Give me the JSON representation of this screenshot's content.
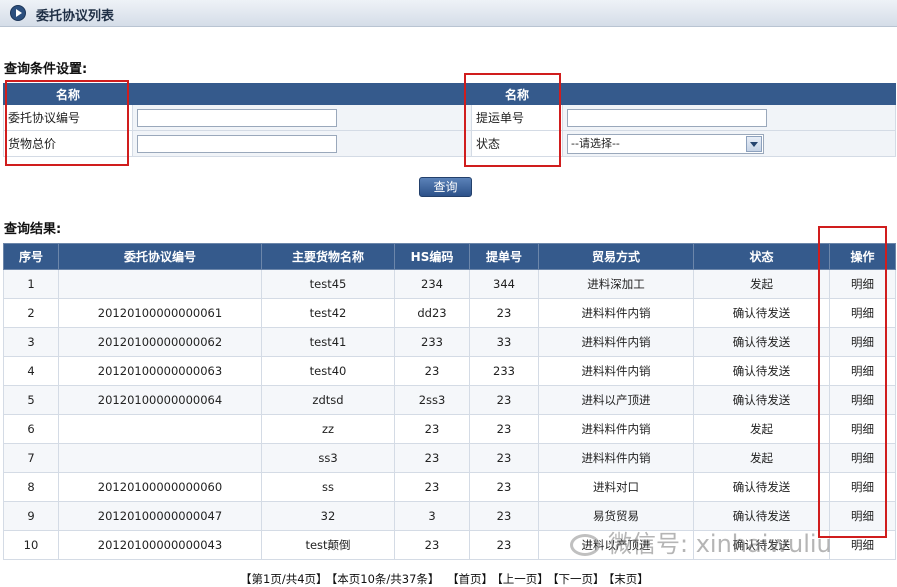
{
  "header": {
    "title": "委托协议列表"
  },
  "query": {
    "section_label": "查询条件设置:",
    "col_header_left": "名称",
    "col_header_right": "名称",
    "fields": {
      "agreement_no_label": "委托协议编号",
      "bill_no_label": "提运单号",
      "total_price_label": "货物总价",
      "status_label": "状态",
      "status_selected": "--请选择--"
    },
    "button_label": "查询"
  },
  "results": {
    "section_label": "查询结果:",
    "columns": [
      "序号",
      "委托协议编号",
      "主要货物名称",
      "HS编码",
      "提单号",
      "贸易方式",
      "状态",
      "操作"
    ],
    "rows": [
      [
        "1",
        "",
        "test45",
        "234",
        "344",
        "进料深加工",
        "发起",
        "明细"
      ],
      [
        "2",
        "20120100000000061",
        "test42",
        "dd23",
        "23",
        "进料料件内销",
        "确认待发送",
        "明细"
      ],
      [
        "3",
        "20120100000000062",
        "test41",
        "233",
        "33",
        "进料料件内销",
        "确认待发送",
        "明细"
      ],
      [
        "4",
        "20120100000000063",
        "test40",
        "23",
        "233",
        "进料料件内销",
        "确认待发送",
        "明细"
      ],
      [
        "5",
        "20120100000000064",
        "zdtsd",
        "2ss3",
        "23",
        "进料以产顶进",
        "确认待发送",
        "明细"
      ],
      [
        "6",
        "",
        "zz",
        "23",
        "23",
        "进料料件内销",
        "发起",
        "明细"
      ],
      [
        "7",
        "",
        "ss3",
        "23",
        "23",
        "进料料件内销",
        "发起",
        "明细"
      ],
      [
        "8",
        "20120100000000060",
        "ss",
        "23",
        "23",
        "进料对口",
        "确认待发送",
        "明细"
      ],
      [
        "9",
        "20120100000000047",
        "32",
        "3",
        "23",
        "易货贸易",
        "确认待发送",
        "明细"
      ],
      [
        "10",
        "20120100000000043",
        "test颠倒",
        "23",
        "23",
        "进料以产顶进",
        "确认待发送",
        "明细"
      ]
    ]
  },
  "pager": {
    "page_info": "【第1页/共4页】",
    "count_info": "【本页10条/共37条】",
    "first": "【首页】",
    "prev": "【上一页】",
    "next": "【下一页】",
    "last": "【末页】"
  },
  "watermark": {
    "text": "微信号: xinhaiwuliu"
  },
  "colors": {
    "header_blue": "#355a8c",
    "highlight_red": "#d01d1d"
  }
}
